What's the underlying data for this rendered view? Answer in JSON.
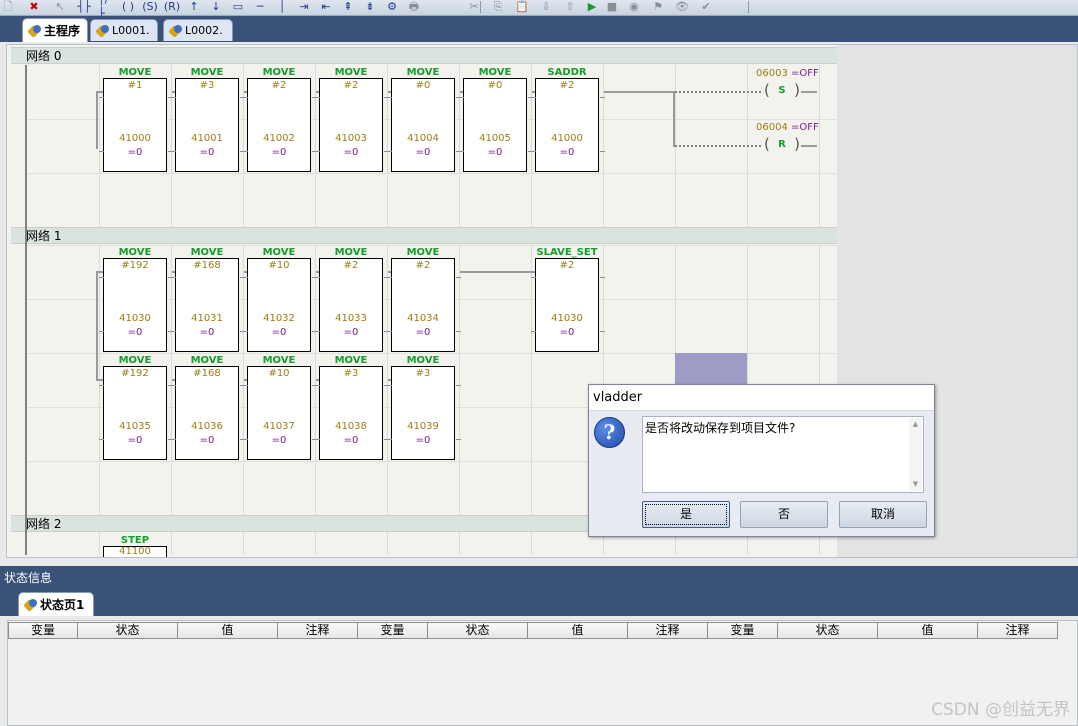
{
  "toolbar": {
    "icons": [
      "new-icon",
      "delete-icon",
      "select-icon",
      "contact-no-icon",
      "contact-nc-icon",
      "output-coil-icon",
      "set-coil-icon",
      "reset-coil-icon",
      "rising-edge-icon",
      "falling-edge-icon",
      "function-block-icon",
      "hline-icon",
      "vline-icon",
      "insert-row-icon",
      "insert-col-icon",
      "delete-row-icon",
      "delete-col-icon",
      "compile-icon",
      "print-icon",
      "cut-icon",
      "copy-icon",
      "paste-icon",
      "download-icon",
      "upload-icon",
      "run-icon",
      "stop-icon",
      "monitor-icon",
      "force-icon",
      "watch-icon",
      "check-icon"
    ]
  },
  "tabs": [
    {
      "label": "主程序"
    },
    {
      "label": "L0001."
    },
    {
      "label": "L0002."
    }
  ],
  "networks": [
    {
      "label": "网络 0"
    },
    {
      "label": "网络 1"
    },
    {
      "label": "网络 2"
    }
  ],
  "net0_blocks": [
    {
      "name": "MOVE",
      "const": "#1",
      "addr": "41000",
      "value": "=0"
    },
    {
      "name": "MOVE",
      "const": "#3",
      "addr": "41001",
      "value": "=0"
    },
    {
      "name": "MOVE",
      "const": "#2",
      "addr": "41002",
      "value": "=0"
    },
    {
      "name": "MOVE",
      "const": "#2",
      "addr": "41003",
      "value": "=0"
    },
    {
      "name": "MOVE",
      "const": "#0",
      "addr": "41004",
      "value": "=0"
    },
    {
      "name": "MOVE",
      "const": "#0",
      "addr": "41005",
      "value": "=0"
    },
    {
      "name": "SADDR",
      "const": "#2",
      "addr": "41000",
      "value": "=0"
    }
  ],
  "net0_coils": [
    {
      "addr": "06003",
      "state": "=OFF",
      "type": "S"
    },
    {
      "addr": "06004",
      "state": "=OFF",
      "type": "R"
    }
  ],
  "net1_row1": [
    {
      "name": "MOVE",
      "const": "#192",
      "addr": "41030",
      "value": "=0"
    },
    {
      "name": "MOVE",
      "const": "#168",
      "addr": "41031",
      "value": "=0"
    },
    {
      "name": "MOVE",
      "const": "#10",
      "addr": "41032",
      "value": "=0"
    },
    {
      "name": "MOVE",
      "const": "#2",
      "addr": "41033",
      "value": "=0"
    },
    {
      "name": "MOVE",
      "const": "#2",
      "addr": "41034",
      "value": "=0"
    }
  ],
  "net1_slave": {
    "name": "SLAVE_SET",
    "const": "#2",
    "addr": "41030",
    "value": "=0"
  },
  "net1_row2": [
    {
      "name": "MOVE",
      "const": "#192",
      "addr": "41035",
      "value": "=0"
    },
    {
      "name": "MOVE",
      "const": "#168",
      "addr": "41036",
      "value": "=0"
    },
    {
      "name": "MOVE",
      "const": "#10",
      "addr": "41037",
      "value": "=0"
    },
    {
      "name": "MOVE",
      "const": "#3",
      "addr": "41038",
      "value": "=0"
    },
    {
      "name": "MOVE",
      "const": "#3",
      "addr": "41039",
      "value": "=0"
    }
  ],
  "net2_block": {
    "name": "STEP",
    "addr": "41100"
  },
  "dialog": {
    "title": "vladder",
    "message": "是否将改动保存到项目文件?",
    "buttons": {
      "yes": "是",
      "no": "否",
      "cancel": "取消"
    }
  },
  "status": {
    "header": "状态信息",
    "tab": "状态页1",
    "columns": [
      "变量",
      "状态",
      "值",
      "注释",
      "变量",
      "状态",
      "值",
      "注释",
      "变量",
      "状态",
      "值",
      "注释"
    ]
  },
  "watermark": "CSDN @创益无界"
}
